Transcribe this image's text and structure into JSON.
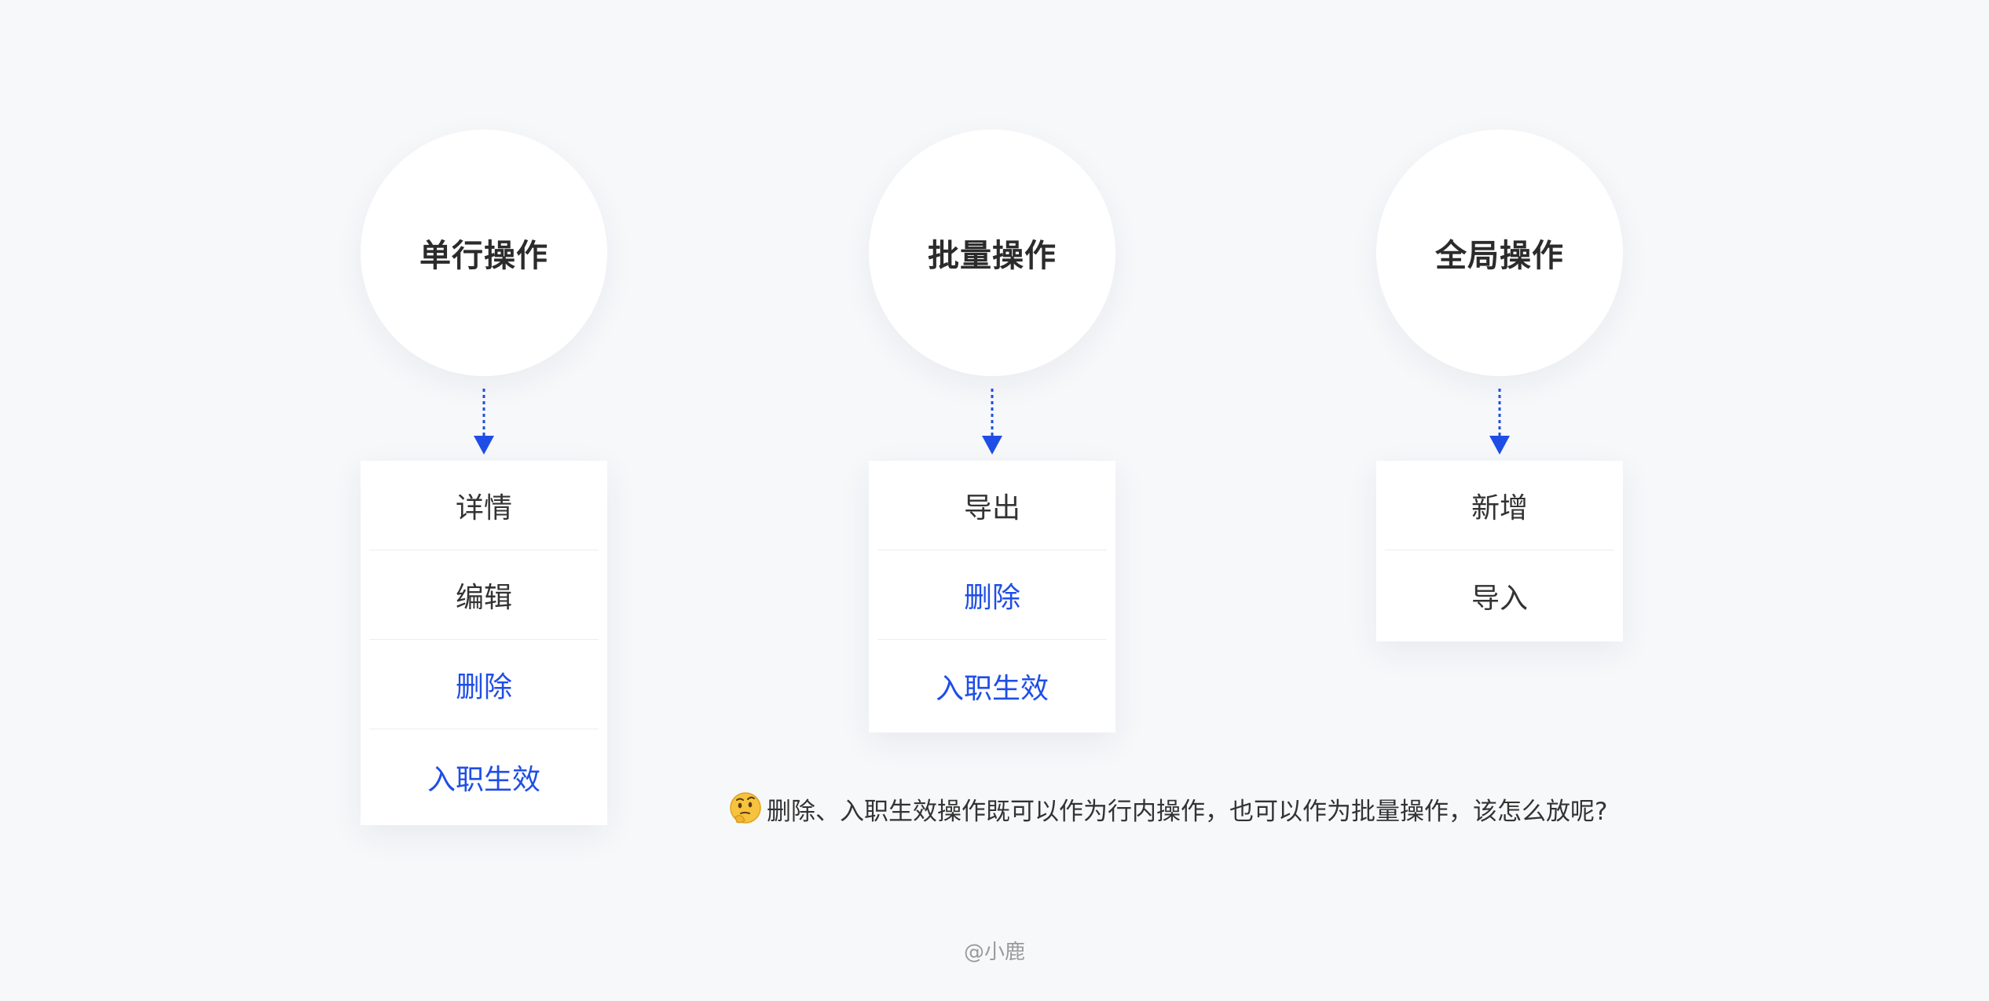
{
  "columns": [
    {
      "title": "单行操作",
      "items": [
        {
          "label": "详情",
          "tone": "default"
        },
        {
          "label": "编辑",
          "tone": "default"
        },
        {
          "label": "删除",
          "tone": "blue"
        },
        {
          "label": "入职生效",
          "tone": "blue"
        }
      ]
    },
    {
      "title": "批量操作",
      "items": [
        {
          "label": "导出",
          "tone": "default"
        },
        {
          "label": "删除",
          "tone": "blue"
        },
        {
          "label": "入职生效",
          "tone": "blue"
        }
      ]
    },
    {
      "title": "全局操作",
      "items": [
        {
          "label": "新增",
          "tone": "default"
        },
        {
          "label": "导入",
          "tone": "default"
        }
      ]
    }
  ],
  "question": {
    "icon": "thinking-face-emoji",
    "text": "删除、入职生效操作既可以作为行内操作，也可以作为批量操作，该怎么放呢?"
  },
  "credit": "@小鹿",
  "colors": {
    "background": "#f7f8fa",
    "accent": "#1f4ee6",
    "text": "#333333"
  }
}
